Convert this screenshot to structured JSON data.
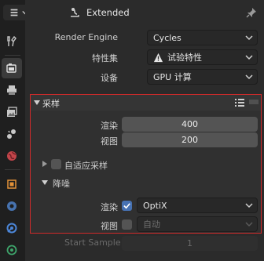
{
  "header": {
    "object_name": "Extended",
    "editor_icon": "wrench-icon",
    "object_icon": "object-data-icon",
    "pin_icon": "pin-icon"
  },
  "render_engine": {
    "label": "Render Engine",
    "value": "Cycles"
  },
  "feature_set": {
    "label": "特性集",
    "value": "试验特性",
    "icon": "warning-icon"
  },
  "device": {
    "label": "设备",
    "value": "GPU 计算"
  },
  "sampling": {
    "title": "采样",
    "render": {
      "label": "渲染",
      "value": "400"
    },
    "viewport": {
      "label": "视图",
      "value": "200"
    },
    "adaptive": {
      "label": "自适应采样",
      "checked": false
    },
    "denoise": {
      "title": "降噪",
      "render": {
        "label": "渲染",
        "checked": true,
        "value": "OptiX"
      },
      "viewport": {
        "label": "视图",
        "checked": false,
        "value": "自动"
      }
    }
  },
  "start_sample": {
    "label": "Start Sample",
    "value": "1"
  },
  "colors": {
    "accent": "#4772b3",
    "highlight_border": "#d12a2a",
    "warning": "#e5a53a"
  },
  "tabs": [
    "tool-tab",
    "render-tab",
    "output-tab",
    "view-layer-tab",
    "scene-tab",
    "world-tab",
    "object-tab",
    "modifier-tab",
    "particles-tab",
    "physics-tab"
  ]
}
